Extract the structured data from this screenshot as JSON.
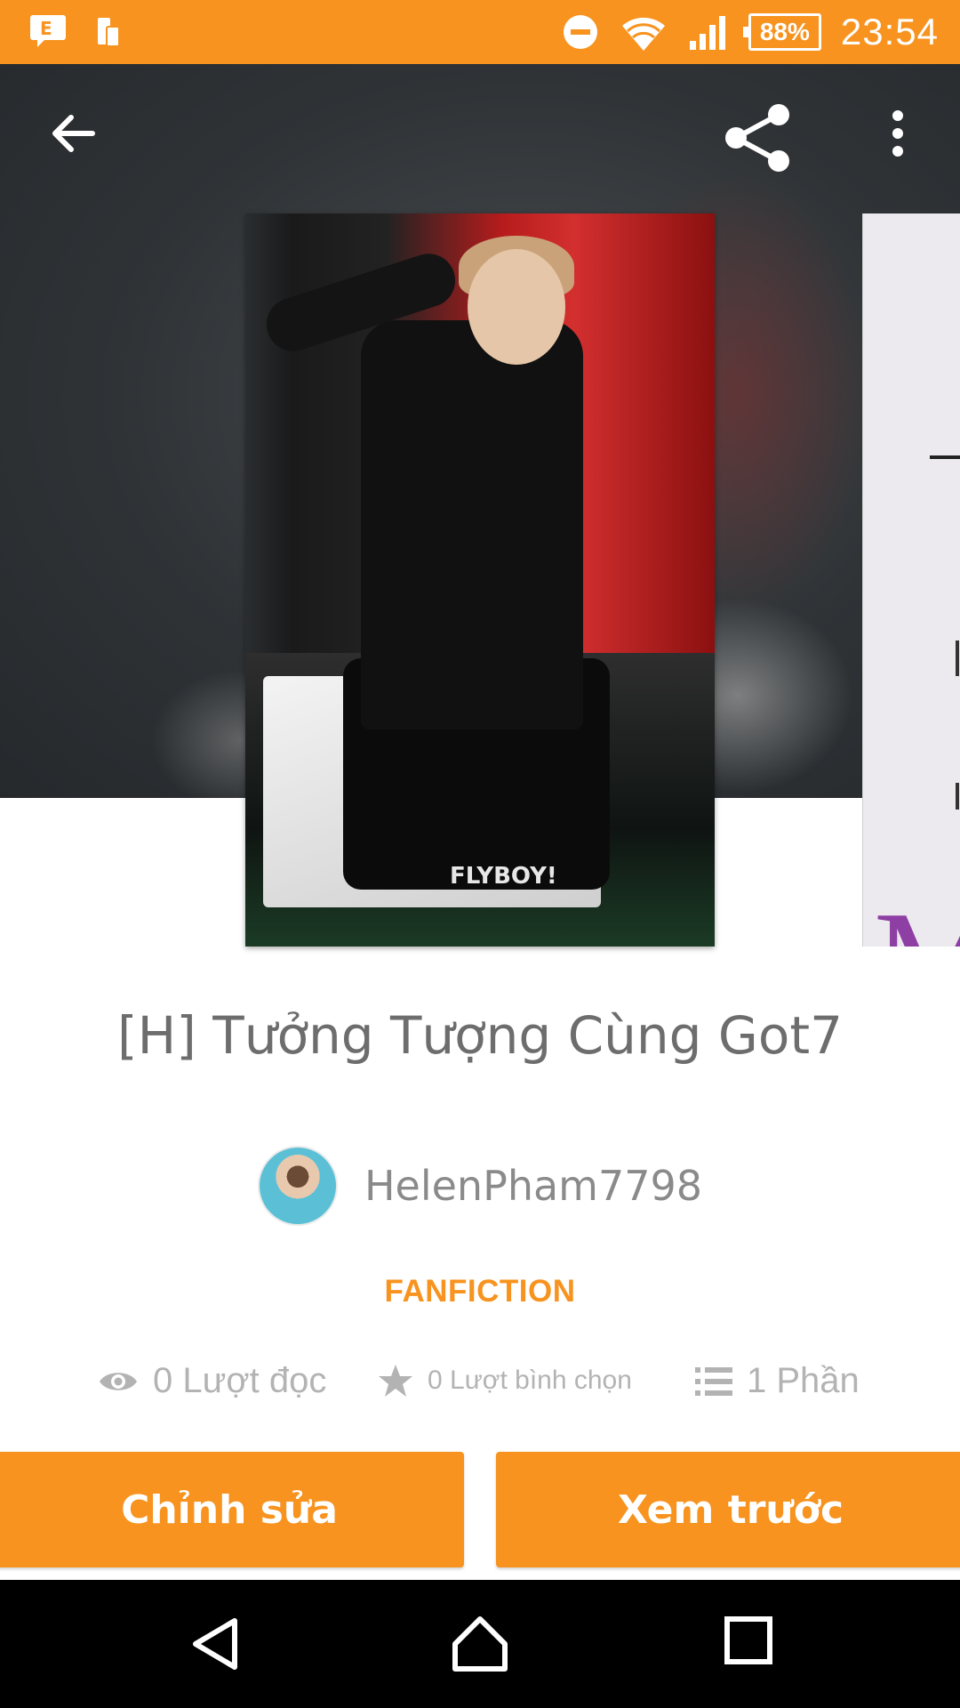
{
  "status_bar": {
    "battery_percent": "88%",
    "time": "23:54",
    "icons": [
      "message-icon",
      "phone-device-icon",
      "do-not-disturb-icon",
      "wifi-icon",
      "signal-icon",
      "battery-icon"
    ]
  },
  "toolbar": {
    "icons": [
      "back-arrow-icon",
      "share-icon",
      "more-vert-icon"
    ]
  },
  "story": {
    "title": "[H] Tưởng Tượng Cùng Got7",
    "author": "HelenPham7798",
    "category": "FANFICTION",
    "cover_watermark": "FLYBOY!",
    "next_cover_letter": "M"
  },
  "stats": {
    "reads": "0 Lượt đọc",
    "votes": "0 Lượt bình chọn",
    "parts": "1 Phần"
  },
  "actions": {
    "edit_label": "Chỉnh sửa",
    "preview_label": "Xem trước"
  },
  "colors": {
    "accent": "#f7931e",
    "text_muted": "#b3b3b3",
    "title_text": "#6d6d6d"
  }
}
